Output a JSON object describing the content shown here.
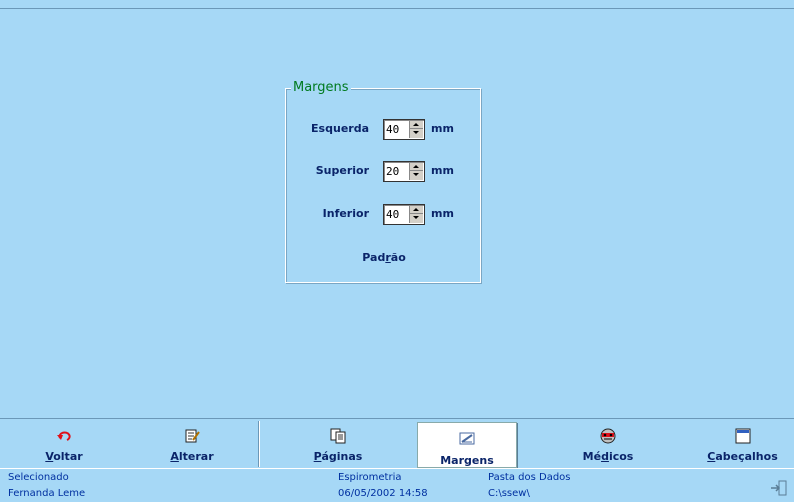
{
  "margins": {
    "legend": "Margens",
    "fields": [
      {
        "label": "Esquerda",
        "value": "40",
        "unit": "mm"
      },
      {
        "label": "Superior",
        "value": "20",
        "unit": "mm"
      },
      {
        "label": "Inferior",
        "value": "40",
        "unit": "mm"
      }
    ],
    "default_button": {
      "pre": "Pad",
      "ul": "r",
      "post": "ão"
    }
  },
  "toolbar": {
    "items": [
      {
        "icon": "undo-icon",
        "ul": "V",
        "rest": "oltar",
        "active": false
      },
      {
        "icon": "edit-icon",
        "ul": "A",
        "rest": "lterar",
        "active": false
      },
      {
        "icon": "pages-icon",
        "ul": "P",
        "rest": "áginas",
        "active": false
      },
      {
        "icon": "margins-icon",
        "ul": "",
        "rest": "Margens",
        "active": true
      },
      {
        "icon": "doctors-icon",
        "pre": "Mé",
        "ul": "d",
        "rest": "icos",
        "active": false
      },
      {
        "icon": "headers-icon",
        "ul": "C",
        "rest": "abeçalhos",
        "active": false
      }
    ]
  },
  "status": {
    "selected_label": "Selecionado",
    "user": "Fernanda Leme",
    "module": "Espirometria",
    "datetime": "06/05/2002 14:58",
    "folder_label": "Pasta dos Dados",
    "folder_path": "C:\\ssew\\"
  },
  "colors": {
    "background": "#a6d8f6",
    "text_dark_blue": "#0a2469",
    "legend_green": "#007a1f",
    "status_blue": "#0030a0"
  }
}
